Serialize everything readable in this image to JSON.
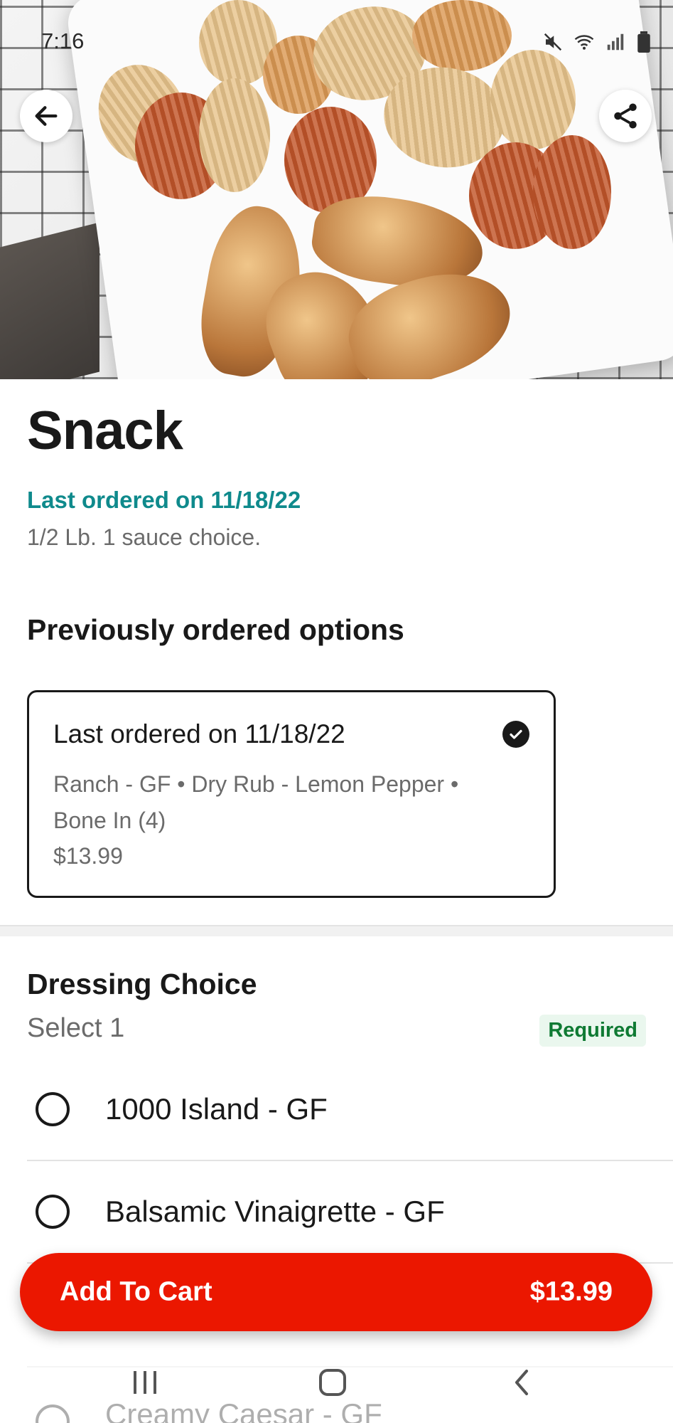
{
  "status_bar": {
    "time": "7:16"
  },
  "item": {
    "title": "Snack",
    "last_ordered": "Last ordered on 11/18/22",
    "description": "1/2 Lb. 1 sauce choice."
  },
  "previous_options": {
    "heading": "Previously ordered options",
    "card": {
      "title": "Last ordered on 11/18/22",
      "details": "Ranch - GF • Dry Rub - Lemon Pepper • Bone In (4)",
      "price": "$13.99"
    }
  },
  "dressing": {
    "heading": "Dressing Choice",
    "subheading": "Select 1",
    "badge": "Required",
    "options": [
      {
        "label": "1000 Island - GF"
      },
      {
        "label": "Balsamic Vinaigrette - GF"
      },
      {
        "label": "Creamy Caesar - GF"
      }
    ]
  },
  "cart_button": {
    "label": "Add To Cart",
    "price": "$13.99"
  },
  "colors": {
    "accent": "#eb1700",
    "teal": "#0f8a8c",
    "required_green": "#0f7a33"
  }
}
